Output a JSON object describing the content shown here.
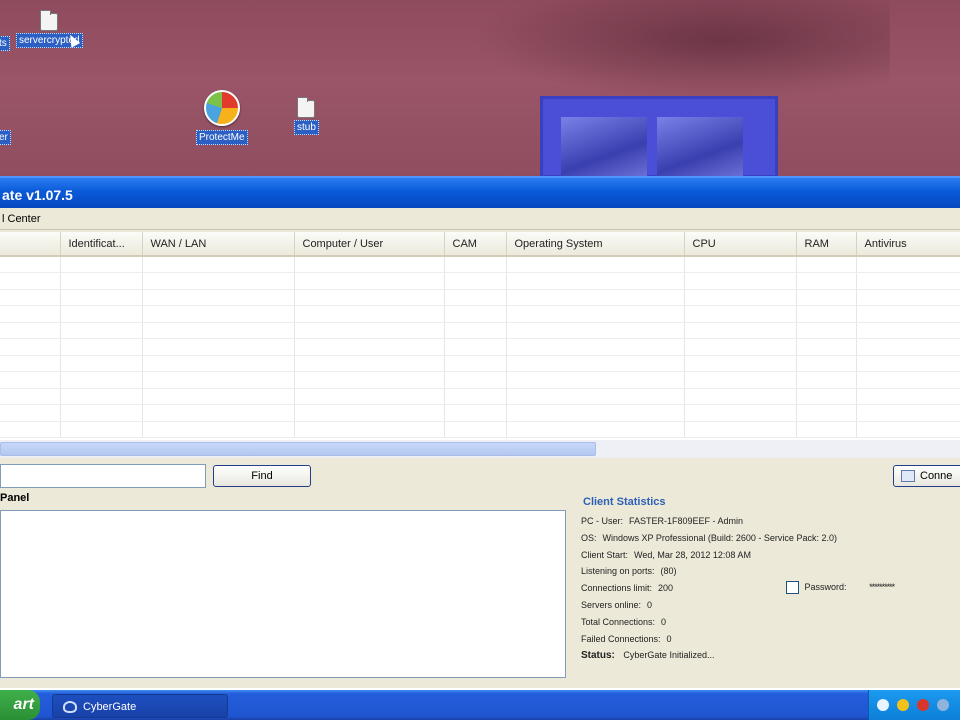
{
  "desktop": {
    "icons": [
      {
        "label": "ts"
      },
      {
        "label": "servercrypted"
      },
      {
        "label": "er"
      },
      {
        "label": "ProtectMe"
      },
      {
        "label": "stub"
      }
    ]
  },
  "window": {
    "title": "ate v1.07.5",
    "menu": [
      "l Center"
    ]
  },
  "grid": {
    "columns": [
      "",
      "Identificat...",
      "WAN / LAN",
      "Computer / User",
      "CAM",
      "Operating System",
      "CPU",
      "RAM",
      "Antivirus"
    ],
    "rows": 11
  },
  "search": {
    "input_value": "",
    "find_label": "Find",
    "connect_label": "Conne"
  },
  "panel": {
    "title": "Panel",
    "log_text": ""
  },
  "stats": {
    "title": "Client Statistics",
    "lines": [
      {
        "label": "PC - User:",
        "value": "FASTER-1F809EEF - Admin"
      },
      {
        "label": "OS:",
        "value": "Windows XP Professional (Build: 2600 - Service Pack: 2.0)"
      },
      {
        "label": "Client Start:",
        "value": "Wed, Mar 28, 2012    12:08 AM"
      },
      {
        "label": "Listening on ports:",
        "value": "(80)"
      },
      {
        "label": "Connections limit:",
        "value": "200"
      },
      {
        "label": "Servers online:",
        "value": "0"
      },
      {
        "label": "Total Connections:",
        "value": "0"
      },
      {
        "label": "Failed Connections:",
        "value": "0"
      }
    ],
    "status_label": "Status:",
    "status_value": "CyberGate Initialized...",
    "password_label": "Password:",
    "password_value": "**********"
  },
  "taskbar": {
    "start_label": "art",
    "task_label": "CyberGate"
  },
  "colors": {
    "titlebar": "#0a5ad8",
    "taskbar": "#245edc",
    "stats_title": "#2d5fb8",
    "desktop": "#8e4b5d"
  }
}
